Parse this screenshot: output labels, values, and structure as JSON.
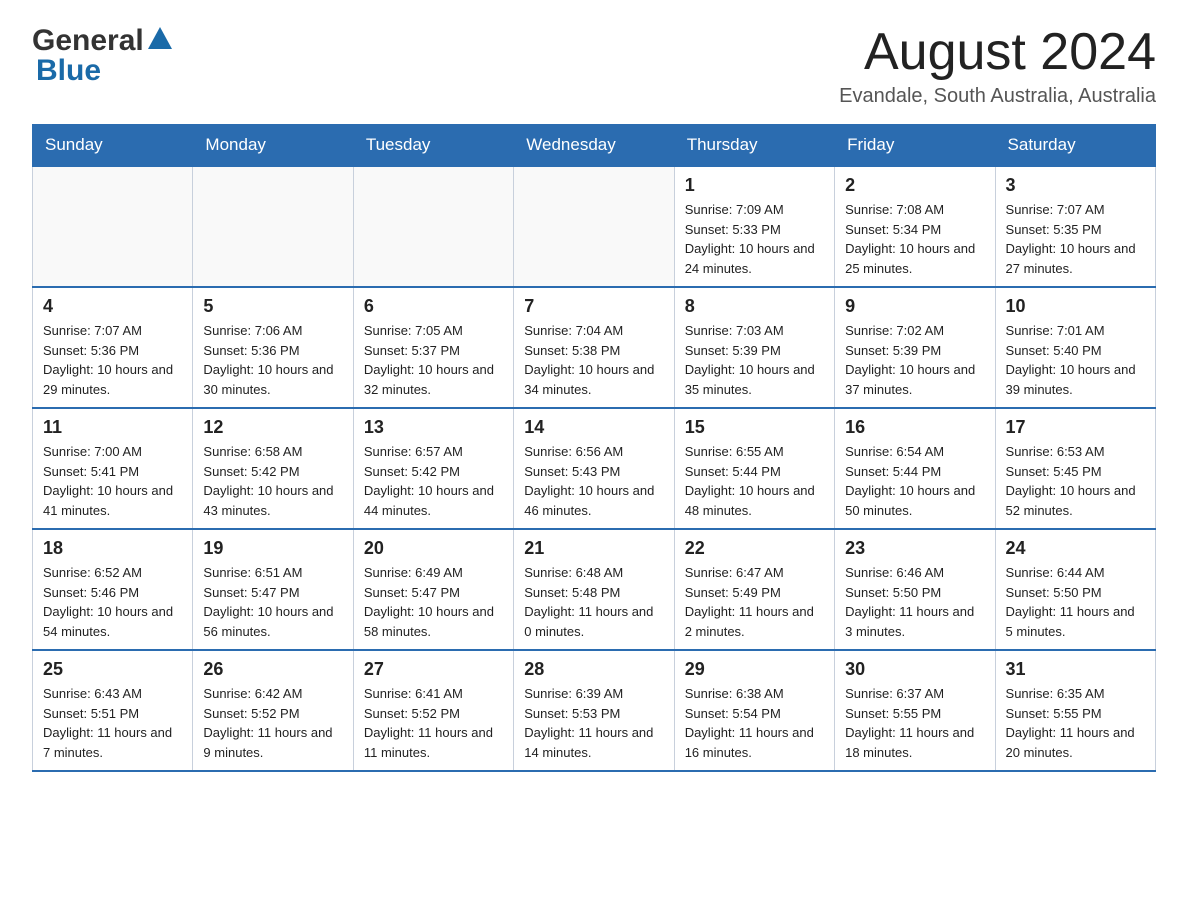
{
  "header": {
    "logo_general": "General",
    "logo_blue": "Blue",
    "month_title": "August 2024",
    "location": "Evandale, South Australia, Australia"
  },
  "days_of_week": [
    "Sunday",
    "Monday",
    "Tuesday",
    "Wednesday",
    "Thursday",
    "Friday",
    "Saturday"
  ],
  "weeks": [
    [
      {
        "day": "",
        "sunrise": "",
        "sunset": "",
        "daylight": ""
      },
      {
        "day": "",
        "sunrise": "",
        "sunset": "",
        "daylight": ""
      },
      {
        "day": "",
        "sunrise": "",
        "sunset": "",
        "daylight": ""
      },
      {
        "day": "",
        "sunrise": "",
        "sunset": "",
        "daylight": ""
      },
      {
        "day": "1",
        "sunrise": "Sunrise: 7:09 AM",
        "sunset": "Sunset: 5:33 PM",
        "daylight": "Daylight: 10 hours and 24 minutes."
      },
      {
        "day": "2",
        "sunrise": "Sunrise: 7:08 AM",
        "sunset": "Sunset: 5:34 PM",
        "daylight": "Daylight: 10 hours and 25 minutes."
      },
      {
        "day": "3",
        "sunrise": "Sunrise: 7:07 AM",
        "sunset": "Sunset: 5:35 PM",
        "daylight": "Daylight: 10 hours and 27 minutes."
      }
    ],
    [
      {
        "day": "4",
        "sunrise": "Sunrise: 7:07 AM",
        "sunset": "Sunset: 5:36 PM",
        "daylight": "Daylight: 10 hours and 29 minutes."
      },
      {
        "day": "5",
        "sunrise": "Sunrise: 7:06 AM",
        "sunset": "Sunset: 5:36 PM",
        "daylight": "Daylight: 10 hours and 30 minutes."
      },
      {
        "day": "6",
        "sunrise": "Sunrise: 7:05 AM",
        "sunset": "Sunset: 5:37 PM",
        "daylight": "Daylight: 10 hours and 32 minutes."
      },
      {
        "day": "7",
        "sunrise": "Sunrise: 7:04 AM",
        "sunset": "Sunset: 5:38 PM",
        "daylight": "Daylight: 10 hours and 34 minutes."
      },
      {
        "day": "8",
        "sunrise": "Sunrise: 7:03 AM",
        "sunset": "Sunset: 5:39 PM",
        "daylight": "Daylight: 10 hours and 35 minutes."
      },
      {
        "day": "9",
        "sunrise": "Sunrise: 7:02 AM",
        "sunset": "Sunset: 5:39 PM",
        "daylight": "Daylight: 10 hours and 37 minutes."
      },
      {
        "day": "10",
        "sunrise": "Sunrise: 7:01 AM",
        "sunset": "Sunset: 5:40 PM",
        "daylight": "Daylight: 10 hours and 39 minutes."
      }
    ],
    [
      {
        "day": "11",
        "sunrise": "Sunrise: 7:00 AM",
        "sunset": "Sunset: 5:41 PM",
        "daylight": "Daylight: 10 hours and 41 minutes."
      },
      {
        "day": "12",
        "sunrise": "Sunrise: 6:58 AM",
        "sunset": "Sunset: 5:42 PM",
        "daylight": "Daylight: 10 hours and 43 minutes."
      },
      {
        "day": "13",
        "sunrise": "Sunrise: 6:57 AM",
        "sunset": "Sunset: 5:42 PM",
        "daylight": "Daylight: 10 hours and 44 minutes."
      },
      {
        "day": "14",
        "sunrise": "Sunrise: 6:56 AM",
        "sunset": "Sunset: 5:43 PM",
        "daylight": "Daylight: 10 hours and 46 minutes."
      },
      {
        "day": "15",
        "sunrise": "Sunrise: 6:55 AM",
        "sunset": "Sunset: 5:44 PM",
        "daylight": "Daylight: 10 hours and 48 minutes."
      },
      {
        "day": "16",
        "sunrise": "Sunrise: 6:54 AM",
        "sunset": "Sunset: 5:44 PM",
        "daylight": "Daylight: 10 hours and 50 minutes."
      },
      {
        "day": "17",
        "sunrise": "Sunrise: 6:53 AM",
        "sunset": "Sunset: 5:45 PM",
        "daylight": "Daylight: 10 hours and 52 minutes."
      }
    ],
    [
      {
        "day": "18",
        "sunrise": "Sunrise: 6:52 AM",
        "sunset": "Sunset: 5:46 PM",
        "daylight": "Daylight: 10 hours and 54 minutes."
      },
      {
        "day": "19",
        "sunrise": "Sunrise: 6:51 AM",
        "sunset": "Sunset: 5:47 PM",
        "daylight": "Daylight: 10 hours and 56 minutes."
      },
      {
        "day": "20",
        "sunrise": "Sunrise: 6:49 AM",
        "sunset": "Sunset: 5:47 PM",
        "daylight": "Daylight: 10 hours and 58 minutes."
      },
      {
        "day": "21",
        "sunrise": "Sunrise: 6:48 AM",
        "sunset": "Sunset: 5:48 PM",
        "daylight": "Daylight: 11 hours and 0 minutes."
      },
      {
        "day": "22",
        "sunrise": "Sunrise: 6:47 AM",
        "sunset": "Sunset: 5:49 PM",
        "daylight": "Daylight: 11 hours and 2 minutes."
      },
      {
        "day": "23",
        "sunrise": "Sunrise: 6:46 AM",
        "sunset": "Sunset: 5:50 PM",
        "daylight": "Daylight: 11 hours and 3 minutes."
      },
      {
        "day": "24",
        "sunrise": "Sunrise: 6:44 AM",
        "sunset": "Sunset: 5:50 PM",
        "daylight": "Daylight: 11 hours and 5 minutes."
      }
    ],
    [
      {
        "day": "25",
        "sunrise": "Sunrise: 6:43 AM",
        "sunset": "Sunset: 5:51 PM",
        "daylight": "Daylight: 11 hours and 7 minutes."
      },
      {
        "day": "26",
        "sunrise": "Sunrise: 6:42 AM",
        "sunset": "Sunset: 5:52 PM",
        "daylight": "Daylight: 11 hours and 9 minutes."
      },
      {
        "day": "27",
        "sunrise": "Sunrise: 6:41 AM",
        "sunset": "Sunset: 5:52 PM",
        "daylight": "Daylight: 11 hours and 11 minutes."
      },
      {
        "day": "28",
        "sunrise": "Sunrise: 6:39 AM",
        "sunset": "Sunset: 5:53 PM",
        "daylight": "Daylight: 11 hours and 14 minutes."
      },
      {
        "day": "29",
        "sunrise": "Sunrise: 6:38 AM",
        "sunset": "Sunset: 5:54 PM",
        "daylight": "Daylight: 11 hours and 16 minutes."
      },
      {
        "day": "30",
        "sunrise": "Sunrise: 6:37 AM",
        "sunset": "Sunset: 5:55 PM",
        "daylight": "Daylight: 11 hours and 18 minutes."
      },
      {
        "day": "31",
        "sunrise": "Sunrise: 6:35 AM",
        "sunset": "Sunset: 5:55 PM",
        "daylight": "Daylight: 11 hours and 20 minutes."
      }
    ]
  ]
}
